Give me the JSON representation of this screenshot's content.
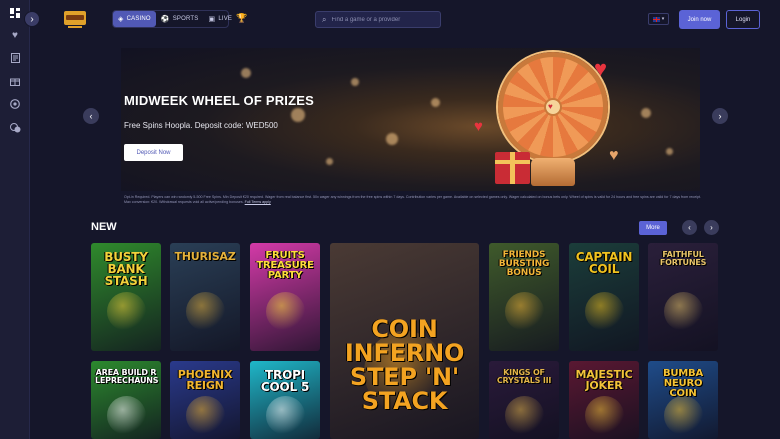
{
  "sidebar": {
    "icons": [
      "grid-icon",
      "heart-icon",
      "receipt-icon",
      "gift-icon",
      "chip-icon",
      "chat-icon"
    ],
    "toggle_glyph": "›"
  },
  "header": {
    "tabs": [
      {
        "label": "CASINO",
        "icon": "casino-icon",
        "active": true
      },
      {
        "label": "SPORTS",
        "icon": "sports-icon",
        "active": false
      },
      {
        "label": "LIVE",
        "icon": "live-icon",
        "active": false
      }
    ],
    "search_placeholder": "Find a game or a provider",
    "join_label": "Join now",
    "login_label": "Login",
    "language": "en-gb"
  },
  "banner": {
    "title": "MIDWEEK WHEEL OF PRIZES",
    "subtitle": "Free Spins Hoopla. Deposit code: WED500",
    "button_label": "Deposit Now",
    "terms": "Opt-in Required. Players can win randomly 5-500 Free Spins. Min Deposit €20 required. Wager from real balance first. 50x wager any winnings from the free spins within 7 days. Contribution varies per game. Available on selected games only. Wager calculated on bonus bets only. Wheel of spins is valid for 24 hours and free spins are valid for 7 days from receipt. Max conversion: €20. Withdrawal requests void all active/pending bonuses.",
    "terms_link": "Full Terms apply"
  },
  "new_section": {
    "title": "NEW",
    "more_label": "More"
  },
  "games": [
    {
      "title": "BUSTY BANK STASH",
      "bg": "#2f8a2c",
      "accent": "#f3d23b"
    },
    {
      "title": "THURISAZ",
      "bg": "#2a3f56",
      "accent": "#e5b23c"
    },
    {
      "title": "FRUITS TREASURE PARTY",
      "bg": "#d43aa8",
      "accent": "#ffde3b"
    },
    {
      "title": "COIN INFERNO STEP 'N' STACK",
      "bg": "#4a3a34",
      "accent": "#f3a321"
    },
    {
      "title": "FRIENDS BURSTING BONUS",
      "bg": "#3f5a2b",
      "accent": "#f3b638"
    },
    {
      "title": "CAPTAIN COIL",
      "bg": "#1b3d3a",
      "accent": "#f0c21f"
    },
    {
      "title": "FAITHFUL FORTUNES",
      "bg": "#2a1f3a",
      "accent": "#e8c46a"
    },
    {
      "title": "AREA BUILD R LEPRECHAUNS",
      "bg": "#2c8a2e",
      "accent": "#ffffff"
    },
    {
      "title": "PHOENIX REIGN",
      "bg": "#2a3a8c",
      "accent": "#f2b630"
    },
    {
      "title": "TROPI COOL 5",
      "bg": "#1fb7c9",
      "accent": "#ffffff"
    },
    {
      "title": "KINGS OF CRYSTALS III",
      "bg": "#2a1a3a",
      "accent": "#e3b54a"
    },
    {
      "title": "MAJESTIC JOKER",
      "bg": "#5a1832",
      "accent": "#f3c33a"
    },
    {
      "title": "BUMBA NEURO COIN",
      "bg": "#1f4c8a",
      "accent": "#f6c435"
    }
  ]
}
